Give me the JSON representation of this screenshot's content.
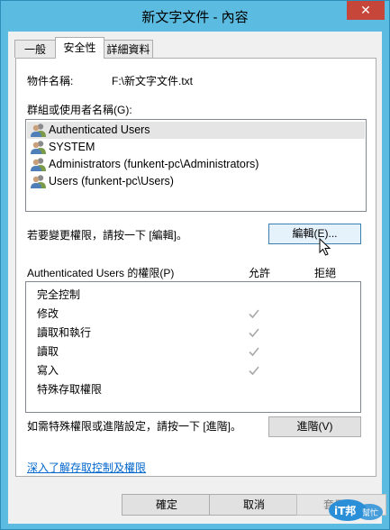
{
  "window": {
    "title": "新文字文件 - 內容",
    "close_glyph": "✕"
  },
  "tabs": [
    {
      "label": "一般"
    },
    {
      "label": "安全性"
    },
    {
      "label": "詳細資料"
    }
  ],
  "object": {
    "label": "物件名稱:",
    "value": "F:\\新文字文件.txt"
  },
  "groups": {
    "label": "群組或使用者名稱(G):",
    "items": [
      {
        "label": "Authenticated Users"
      },
      {
        "label": "SYSTEM"
      },
      {
        "label": "Administrators (funkent-pc\\Administrators)"
      },
      {
        "label": "Users (funkent-pc\\Users)"
      }
    ]
  },
  "edit": {
    "hint": "若要變更權限，請按一下 [編輯]。",
    "button": "編輯(E)..."
  },
  "permissions": {
    "header": "Authenticated Users 的權限(P)",
    "allow": "允許",
    "deny": "拒絕",
    "rows": [
      {
        "label": "完全控制",
        "allow": false
      },
      {
        "label": "修改",
        "allow": true
      },
      {
        "label": "讀取和執行",
        "allow": true
      },
      {
        "label": "讀取",
        "allow": true
      },
      {
        "label": "寫入",
        "allow": true
      },
      {
        "label": "特殊存取權限",
        "allow": false
      }
    ]
  },
  "advanced": {
    "hint": "如需特殊權限或進階設定，請按一下 [進階]。",
    "button": "進階(V)"
  },
  "learn_link": "深入了解存取控制及權限",
  "buttons": {
    "ok": "確定",
    "cancel": "取消",
    "apply": "套用(A)"
  },
  "watermark": {
    "logo": "iT邦",
    "sub": "幫忙"
  },
  "colors": {
    "titlebar": "#5bbbe0",
    "close": "#c7463a",
    "link": "#0066cc",
    "check": "#a9a9a9"
  }
}
